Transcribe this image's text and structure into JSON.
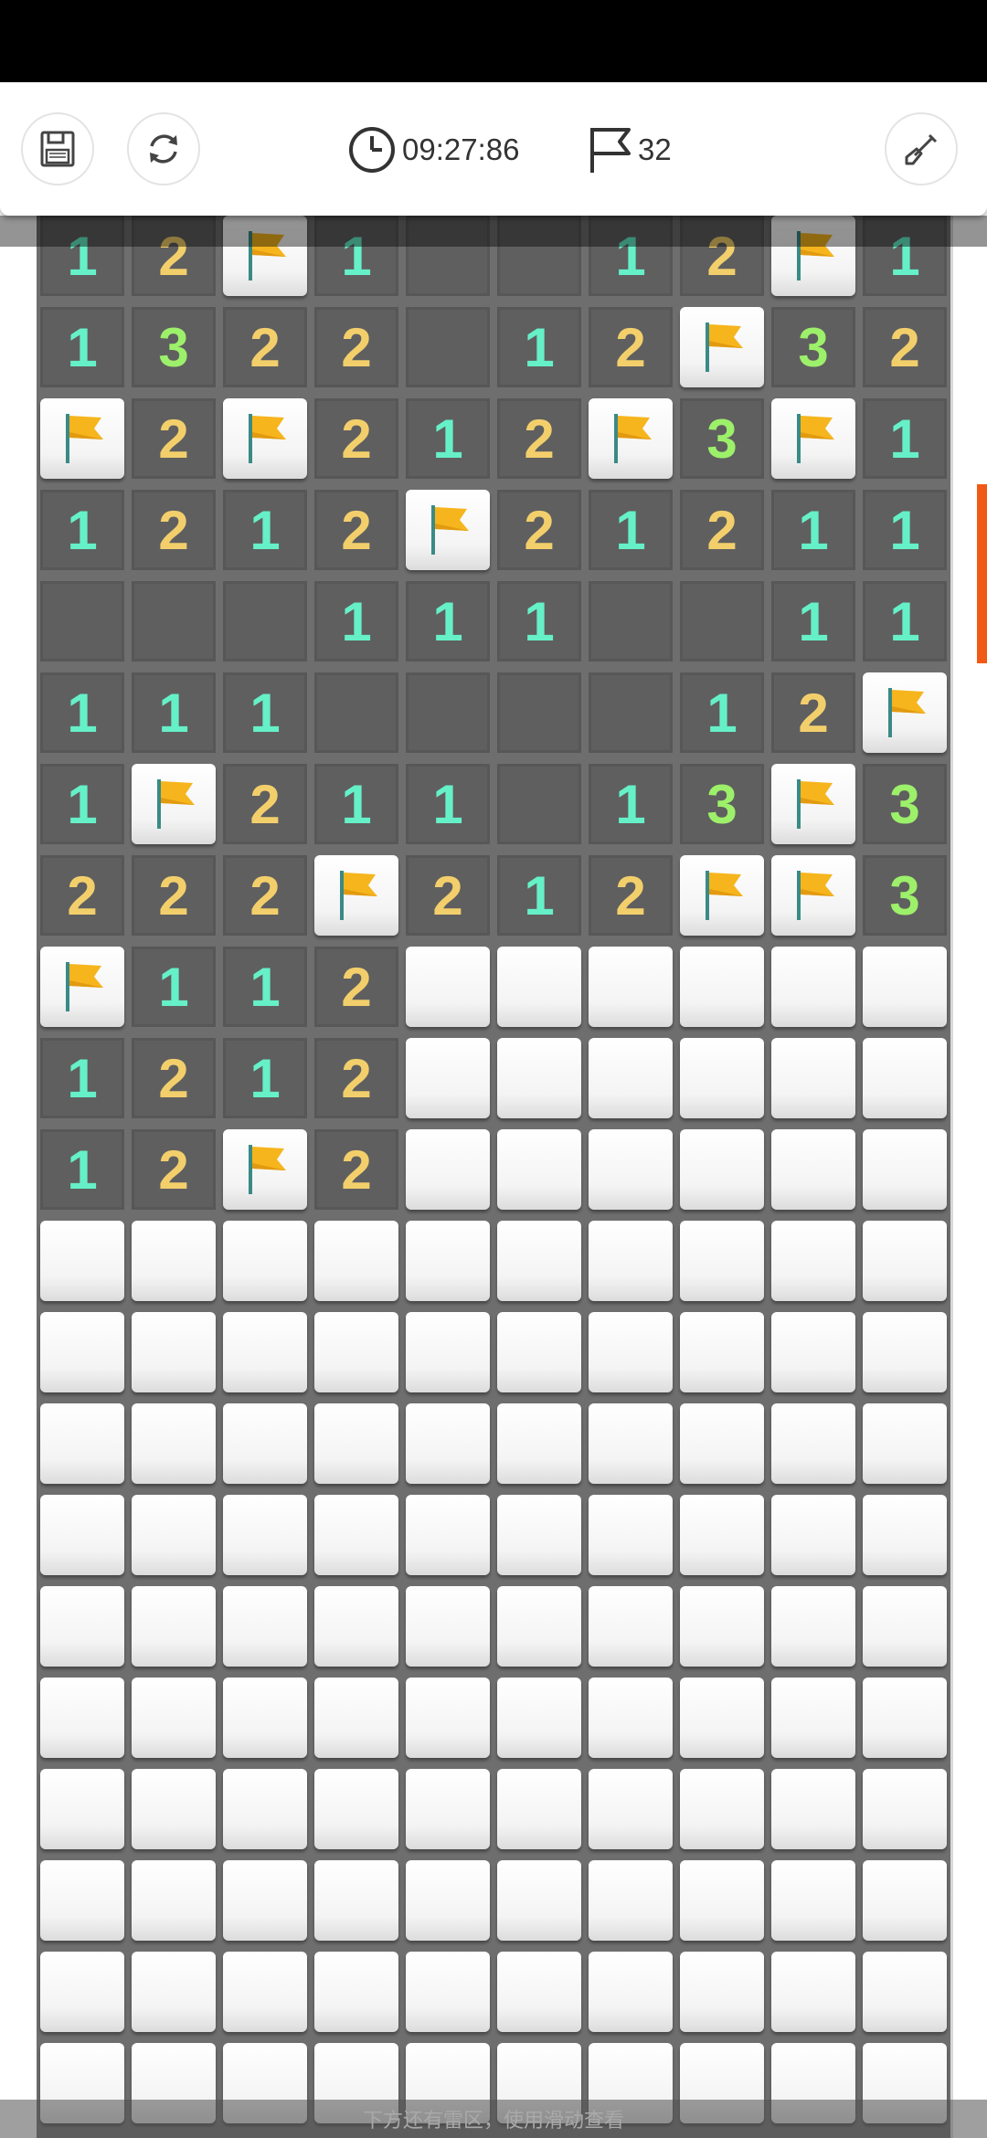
{
  "toolbar": {
    "save_icon": "floppy-disk-icon",
    "restart_icon": "refresh-icon",
    "timer_icon": "clock-icon",
    "timer": "09:27:86",
    "flag_icon": "flag-icon",
    "flag_count": "32",
    "shovel_icon": "shovel-icon"
  },
  "hint": "下方还有雷区，使用滑动查看",
  "colors": {
    "num1": "#66f0c8",
    "num2": "#f3cf6c",
    "num3": "#9df06a",
    "flag": "#f6b51d",
    "accent": "#f15a16"
  },
  "board": {
    "columns": 10,
    "legend": "digit = revealed number, '.' = revealed empty, 'F' = flagged, '#' = unrevealed",
    "rows": [
      [
        "1",
        "2",
        "F",
        "1",
        ".",
        ".",
        "1",
        "2",
        "F",
        "1"
      ],
      [
        "1",
        "3",
        "2",
        "2",
        ".",
        "1",
        "2",
        "F",
        "3",
        "2"
      ],
      [
        "F",
        "2",
        "F",
        "2",
        "1",
        "2",
        "F",
        "3",
        "F",
        "1"
      ],
      [
        "1",
        "2",
        "1",
        "2",
        "F",
        "2",
        "1",
        "2",
        "1",
        "1"
      ],
      [
        ".",
        ".",
        ".",
        "1",
        "1",
        "1",
        ".",
        ".",
        "1",
        "1"
      ],
      [
        "1",
        "1",
        "1",
        ".",
        ".",
        ".",
        ".",
        "1",
        "2",
        "F"
      ],
      [
        "1",
        "F",
        "2",
        "1",
        "1",
        ".",
        "1",
        "3",
        "F",
        "3"
      ],
      [
        "2",
        "2",
        "2",
        "F",
        "2",
        "1",
        "2",
        "F",
        "F",
        "3"
      ],
      [
        "F",
        "1",
        "1",
        "2",
        "#",
        "#",
        "#",
        "#",
        "#",
        "#"
      ],
      [
        "1",
        "2",
        "1",
        "2",
        "#",
        "#",
        "#",
        "#",
        "#",
        "#"
      ],
      [
        "1",
        "2",
        "F",
        "2",
        "#",
        "#",
        "#",
        "#",
        "#",
        "#"
      ],
      [
        "#",
        "#",
        "#",
        "#",
        "#",
        "#",
        "#",
        "#",
        "#",
        "#"
      ],
      [
        "#",
        "#",
        "#",
        "#",
        "#",
        "#",
        "#",
        "#",
        "#",
        "#"
      ],
      [
        "#",
        "#",
        "#",
        "#",
        "#",
        "#",
        "#",
        "#",
        "#",
        "#"
      ],
      [
        "#",
        "#",
        "#",
        "#",
        "#",
        "#",
        "#",
        "#",
        "#",
        "#"
      ],
      [
        "#",
        "#",
        "#",
        "#",
        "#",
        "#",
        "#",
        "#",
        "#",
        "#"
      ],
      [
        "#",
        "#",
        "#",
        "#",
        "#",
        "#",
        "#",
        "#",
        "#",
        "#"
      ],
      [
        "#",
        "#",
        "#",
        "#",
        "#",
        "#",
        "#",
        "#",
        "#",
        "#"
      ],
      [
        "#",
        "#",
        "#",
        "#",
        "#",
        "#",
        "#",
        "#",
        "#",
        "#"
      ],
      [
        "#",
        "#",
        "#",
        "#",
        "#",
        "#",
        "#",
        "#",
        "#",
        "#"
      ],
      [
        "#",
        "#",
        "#",
        "#",
        "#",
        "#",
        "#",
        "#",
        "#",
        "#"
      ]
    ]
  }
}
